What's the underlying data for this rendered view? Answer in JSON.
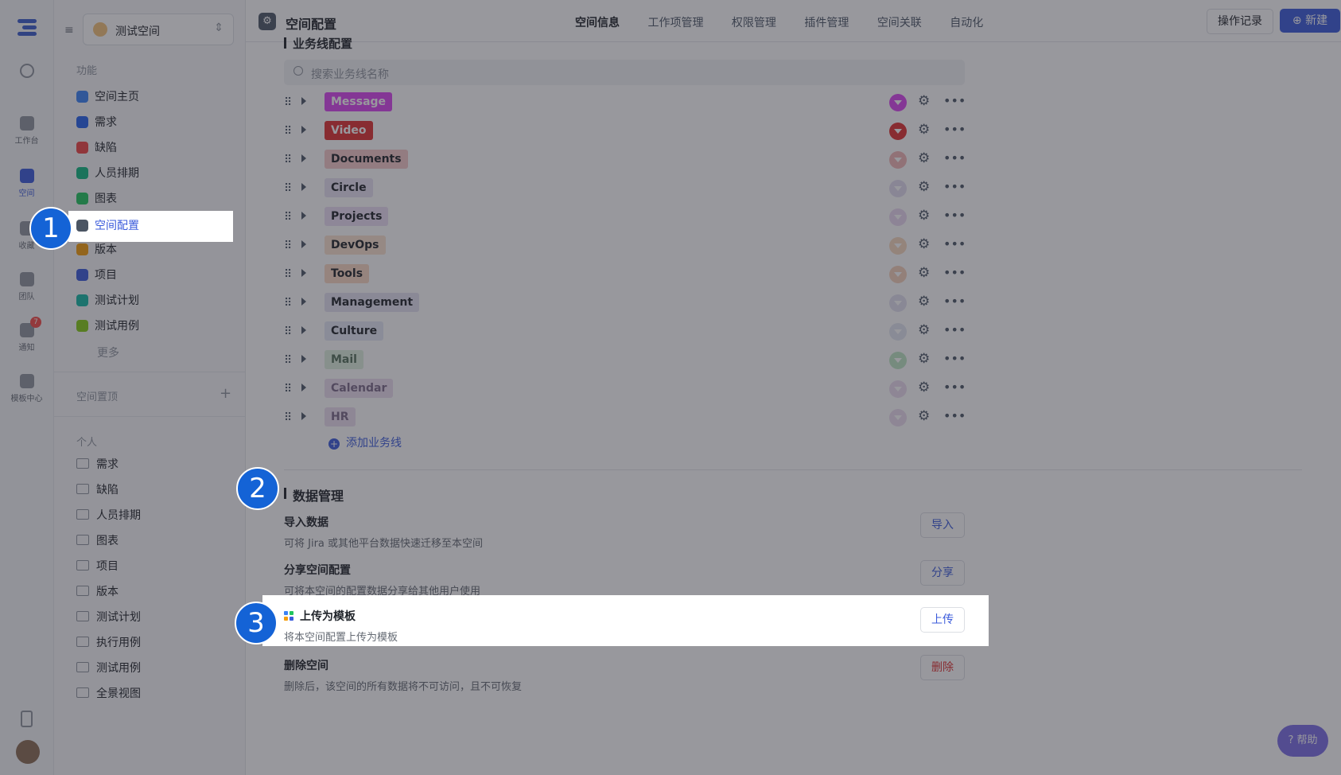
{
  "rail": {
    "items": [
      {
        "label": "",
        "icon": "search-icon"
      },
      {
        "label": "工作台",
        "icon": "home-icon"
      },
      {
        "label": "空间",
        "icon": "space-icon"
      },
      {
        "label": "收藏",
        "icon": "star-icon"
      },
      {
        "label": "团队",
        "icon": "team-icon"
      },
      {
        "label": "通知",
        "icon": "bell-icon",
        "badge": "7"
      },
      {
        "label": "模板中心",
        "icon": "template-icon"
      }
    ]
  },
  "sidebar": {
    "space_name": "测试空间",
    "functions_label": "功能",
    "functions": [
      {
        "label": "空间主页",
        "color": "#3b82f6"
      },
      {
        "label": "需求",
        "color": "#2563eb"
      },
      {
        "label": "缺陷",
        "color": "#ef4444"
      },
      {
        "label": "人员排期",
        "color": "#10b981"
      },
      {
        "label": "图表",
        "color": "#22c55e"
      },
      {
        "label": "空间配置",
        "color": "#4b5563"
      },
      {
        "label": "版本",
        "color": "#f59e0b"
      },
      {
        "label": "项目",
        "color": "#3b5bdb"
      },
      {
        "label": "测试计划",
        "color": "#14b8a6"
      },
      {
        "label": "测试用例",
        "color": "#84cc16"
      }
    ],
    "more_label": "更多",
    "pinned_label": "空间置顶",
    "pinned_add": "+",
    "personal_label": "个人",
    "personal": [
      "需求",
      "缺陷",
      "人员排期",
      "图表",
      "项目",
      "版本",
      "测试计划",
      "执行用例",
      "测试用例",
      "全景视图"
    ]
  },
  "header": {
    "title": "空间配置",
    "tabs": [
      "空间信息",
      "工作项管理",
      "权限管理",
      "插件管理",
      "空间关联",
      "自动化"
    ],
    "log_button": "操作记录",
    "new_button": "新建"
  },
  "business_lines": {
    "section_title": "业务线配置",
    "search_placeholder": "搜索业务线名称",
    "items": [
      {
        "name": "Message",
        "chip_bg": "#d946ef",
        "chip_fg": "#ffffff",
        "dot": "#d946ef"
      },
      {
        "name": "Video",
        "chip_bg": "#e03131",
        "chip_fg": "#ffffff",
        "dot": "#e03131"
      },
      {
        "name": "Documents",
        "chip_bg": "#f6c9c9",
        "chip_fg": "#1f2329",
        "dot": "#f2b6b6"
      },
      {
        "name": "Circle",
        "chip_bg": "#e8e3f3",
        "chip_fg": "#1f2329",
        "dot": "#e3ddf0"
      },
      {
        "name": "Projects",
        "chip_bg": "#ecdff5",
        "chip_fg": "#1f2329",
        "dot": "#ead8f2"
      },
      {
        "name": "DevOps",
        "chip_bg": "#fbe2cf",
        "chip_fg": "#1f2329",
        "dot": "#f7d8bf"
      },
      {
        "name": "Tools",
        "chip_bg": "#fbd9c4",
        "chip_fg": "#1f2329",
        "dot": "#f6d2bb"
      },
      {
        "name": "Management",
        "chip_bg": "#e5e3f2",
        "chip_fg": "#1f2329",
        "dot": "#e3e1f0"
      },
      {
        "name": "Culture",
        "chip_bg": "#e4e9f6",
        "chip_fg": "#1f2329",
        "dot": "#e2e6f2"
      },
      {
        "name": "Mail",
        "chip_bg": "#dff0df",
        "chip_fg": "#55705a",
        "dot": "#bfe6c4"
      },
      {
        "name": "Calendar",
        "chip_bg": "#ecdff0",
        "chip_fg": "#7b6a88",
        "dot": "#ebdcef"
      },
      {
        "name": "HR",
        "chip_bg": "#ecdff0",
        "chip_fg": "#7b6a88",
        "dot": "#ebdcef"
      }
    ],
    "add_label": "添加业务线"
  },
  "data_management": {
    "title": "数据管理",
    "items": [
      {
        "title": "导入数据",
        "desc": "可将 Jira 或其他平台数据快速迁移至本空间",
        "button": "导入"
      },
      {
        "title": "分享空间配置",
        "desc": "可将本空间的配置数据分享给其他用户使用",
        "button": "分享"
      },
      {
        "title": "上传为模板",
        "desc": "将本空间配置上传为模板",
        "button": "上传"
      },
      {
        "title": "删除空间",
        "desc": "删除后，该空间的所有数据将不可访问，且不可恢复",
        "button": "删除"
      }
    ]
  },
  "annotations": [
    "1",
    "2",
    "3"
  ],
  "help_label": "帮助",
  "colors": {
    "accent": "#3b5bdb",
    "danger": "#e03131",
    "badge": "#1463d6"
  }
}
